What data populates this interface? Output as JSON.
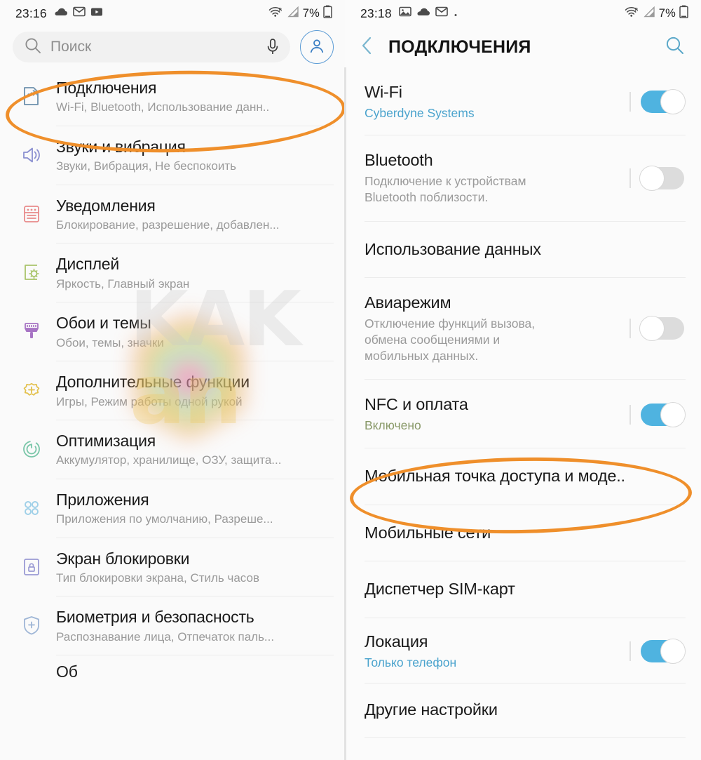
{
  "left_screen": {
    "statusbar": {
      "time": "23:16",
      "icons": [
        "cloud-icon",
        "gmail-icon",
        "youtube-icon"
      ],
      "wifi_icon": "wifi-roaming-icon",
      "signal_icon": "cellular-signal-icon",
      "battery_percent": "7%",
      "battery_icon": "battery-icon"
    },
    "search": {
      "placeholder": "Поиск",
      "search_icon": "search-icon",
      "mic_icon": "microphone-icon",
      "avatar_icon": "account-avatar-icon"
    },
    "items": [
      {
        "title": "Подключения",
        "subtitle": "Wi-Fi, Bluetooth, Использование данн..",
        "icon": "connections-icon",
        "icon_color": "#6d90ac",
        "highlighted": true
      },
      {
        "title": "Звуки и вибрация",
        "subtitle": "Звуки, Вибрация, Не беспокоить",
        "icon": "speaker-icon",
        "icon_color": "#8a8fd0",
        "highlighted": false
      },
      {
        "title": "Уведомления",
        "subtitle": "Блокирование, разрешение, добавлен...",
        "icon": "notifications-icon",
        "icon_color": "#e88b8b",
        "highlighted": false
      },
      {
        "title": "Дисплей",
        "subtitle": "Яркость, Главный экран",
        "icon": "display-brightness-icon",
        "icon_color": "#a9c46a",
        "highlighted": false
      },
      {
        "title": "Обои и темы",
        "subtitle": "Обои, темы, значки",
        "icon": "paintbrush-icon",
        "icon_color": "#a774c4",
        "highlighted": false
      },
      {
        "title": "Дополнительные функции",
        "subtitle": "Игры, Режим работы одной рукой",
        "icon": "advanced-features-icon",
        "icon_color": "#e3c14e",
        "highlighted": false
      },
      {
        "title": "Оптимизация",
        "subtitle": "Аккумулятор, хранилище, ОЗУ, защита...",
        "icon": "optimization-icon",
        "icon_color": "#79c6a8",
        "highlighted": false
      },
      {
        "title": "Приложения",
        "subtitle": "Приложения по умолчанию, Разреше...",
        "icon": "apps-icon",
        "icon_color": "#9fd0e8",
        "highlighted": false
      },
      {
        "title": "Экран блокировки",
        "subtitle": "Тип блокировки экрана, Стиль часов",
        "icon": "lock-screen-icon",
        "icon_color": "#9b9bd4",
        "highlighted": false
      },
      {
        "title": "Биометрия и безопасность",
        "subtitle": "Распознавание лица, Отпечаток паль...",
        "icon": "shield-security-icon",
        "icon_color": "#9fb6d6",
        "highlighted": false
      }
    ]
  },
  "right_screen": {
    "statusbar": {
      "time": "23:18",
      "icons": [
        "photos-icon",
        "cloud-icon",
        "gmail-icon",
        "dot-icon"
      ],
      "wifi_icon": "wifi-roaming-icon",
      "signal_icon": "cellular-signal-icon",
      "battery_percent": "7%",
      "battery_icon": "battery-icon"
    },
    "header": {
      "back_icon": "back-chevron-icon",
      "title": "ПОДКЛЮЧЕНИЯ",
      "search_icon": "search-icon"
    },
    "items": [
      {
        "title": "Wi-Fi",
        "subtitle": "Cyberdyne Systems",
        "subtitle_style": "blue",
        "toggle": "on",
        "highlighted": false
      },
      {
        "title": "Bluetooth",
        "subtitle": "Подключение к устройствам\nBluetooth поблизости.",
        "subtitle_style": "gray",
        "toggle": "off",
        "highlighted": false
      },
      {
        "title": "Использование данных",
        "subtitle": "",
        "subtitle_style": "gray",
        "toggle": "none",
        "highlighted": false
      },
      {
        "title": "Авиарежим",
        "subtitle": "Отключение функций вызова,\nобмена сообщениями и\nмобильных данных.",
        "subtitle_style": "gray",
        "toggle": "off",
        "highlighted": false
      },
      {
        "title": "NFC и оплата",
        "subtitle": "Включено",
        "subtitle_style": "green",
        "toggle": "on",
        "highlighted": false
      },
      {
        "title": "Мобильная точка доступа и моде..",
        "subtitle": "",
        "subtitle_style": "gray",
        "toggle": "none",
        "highlighted": true
      },
      {
        "title": "Мобильные сети",
        "subtitle": "",
        "subtitle_style": "gray",
        "toggle": "none",
        "highlighted": false
      },
      {
        "title": "Диспетчер SIM-карт",
        "subtitle": "",
        "subtitle_style": "gray",
        "toggle": "none",
        "highlighted": false
      },
      {
        "title": "Локация",
        "subtitle": "Только телефон",
        "subtitle_style": "blue",
        "toggle": "on",
        "highlighted": false
      },
      {
        "title": "Другие настройки",
        "subtitle": "",
        "subtitle_style": "gray",
        "toggle": "none",
        "highlighted": false
      }
    ]
  },
  "annotations": {
    "highlight_color": "#ef8f2b",
    "toggle_on_color": "#4fb3e0",
    "toggle_off_color": "#dcdcdc"
  },
  "watermark": {
    "line1": "KAK",
    "line2": "an"
  }
}
